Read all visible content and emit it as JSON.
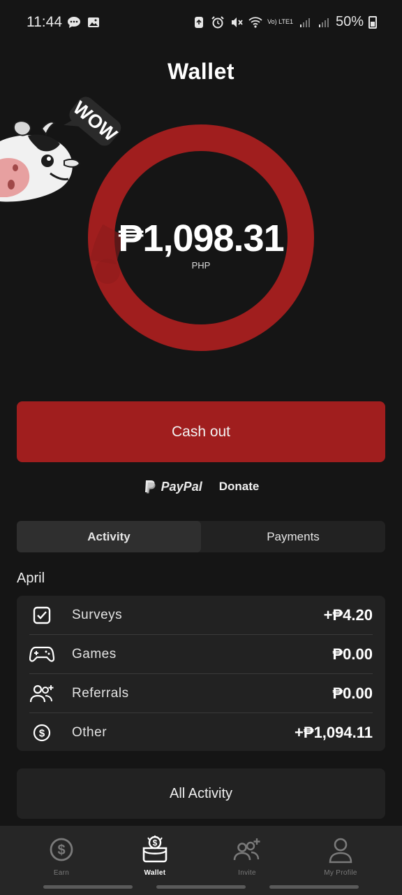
{
  "status_bar": {
    "time": "11:44",
    "battery": "50%",
    "network_label": "Vo) LTE1"
  },
  "header": {
    "title": "Wallet"
  },
  "mascot": {
    "speech": "WOW"
  },
  "balance": {
    "amount": "₱1,098.31",
    "currency": "PHP",
    "ring_color": "#a01e1e"
  },
  "actions": {
    "cashout_label": "Cash out",
    "paypal_label": "PayPal",
    "donate_label": "Donate"
  },
  "tabs": [
    {
      "label": "Activity",
      "active": true
    },
    {
      "label": "Payments",
      "active": false
    }
  ],
  "activity": {
    "month": "April",
    "rows": [
      {
        "icon": "checkbox-icon",
        "label": "Surveys",
        "amount": "+₱4.20"
      },
      {
        "icon": "gamepad-icon",
        "label": "Games",
        "amount": "₱0.00"
      },
      {
        "icon": "referrals-icon",
        "label": "Referrals",
        "amount": "₱0.00"
      },
      {
        "icon": "dollar-coin-icon",
        "label": "Other",
        "amount": "+₱1,094.11"
      }
    ],
    "all_label": "All Activity"
  },
  "nav": [
    {
      "icon": "dollar-coin-icon",
      "label": "Earn",
      "active": false
    },
    {
      "icon": "wallet-icon",
      "label": "Wallet",
      "active": true
    },
    {
      "icon": "invite-icon",
      "label": "Invite",
      "active": false
    },
    {
      "icon": "profile-icon",
      "label": "My Profile",
      "active": false
    }
  ],
  "colors": {
    "background": "#151515",
    "accent": "#a01e1e",
    "card": "#222222"
  }
}
